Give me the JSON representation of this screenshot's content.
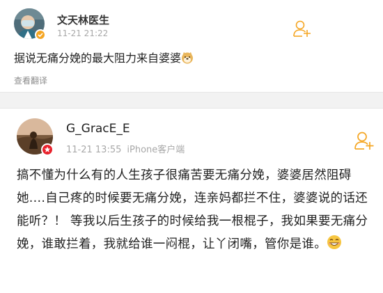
{
  "post1": {
    "username": "文天林医生",
    "timestamp": "11-21 21:22",
    "text": "据说无痛分娩的最大阻力来自婆婆",
    "emoji": "doge-face-icon",
    "translate_label": "查看翻译",
    "badge_color": "#f5a623"
  },
  "post2": {
    "username": "G_GracE_E",
    "timestamp": "11-21 13:55",
    "source": "iPhone客户端",
    "text": "搞不懂为什么有的人生孩子很痛苦要无痛分娩，婆婆居然阻碍她....自己疼的时候要无痛分娩，连亲妈都拦不住，婆婆说的话还能听？！ 等我以后生孩子的时候给我一根棍子，我如果要无痛分娩，谁敢拦着，我就给谁一闷棍，让丫闭嘴，管你是谁。",
    "emoji": "grin-face-icon",
    "badge_color": "#e8222c"
  },
  "colors": {
    "accent": "#f5a623",
    "text": "#222222",
    "meta": "#a8a8a8"
  }
}
